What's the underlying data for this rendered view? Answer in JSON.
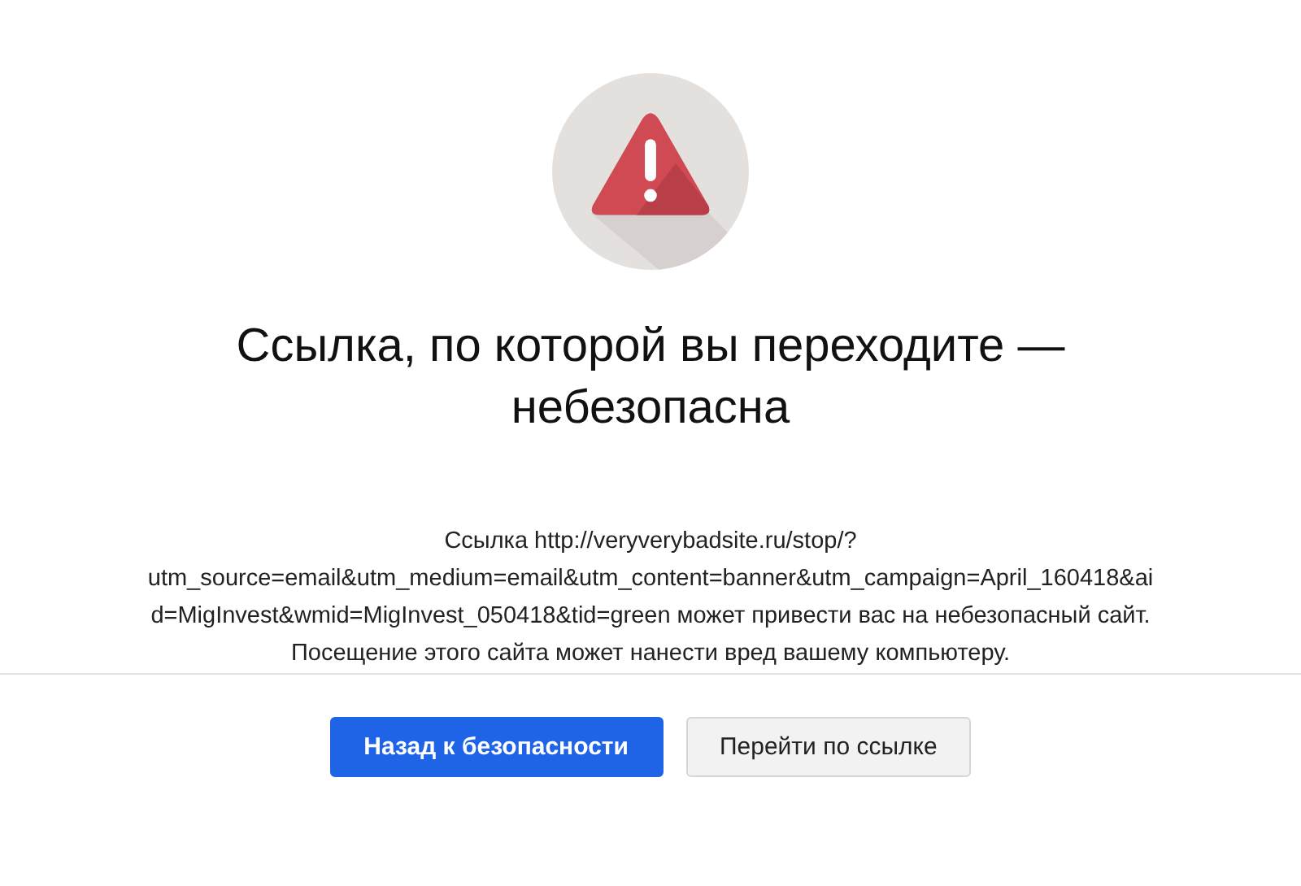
{
  "title": "Ссылка, по которой вы переходите — небезопасна",
  "message": "Ссылка http://veryverybadsite.ru/stop/?utm_source=email&utm_medium=email&utm_content=banner&utm_campaign=April_160418&aid=MigInvest&wmid=MigInvest_050418&tid=green может привести вас на небезопасный сайт.",
  "warning": "Посещение этого сайта может нанести вред вашему компьютеру.",
  "buttons": [
    {
      "label": "Назад к безопасности",
      "kind": "primary"
    },
    {
      "label": "Перейти по ссылке",
      "kind": "secondary"
    }
  ]
}
